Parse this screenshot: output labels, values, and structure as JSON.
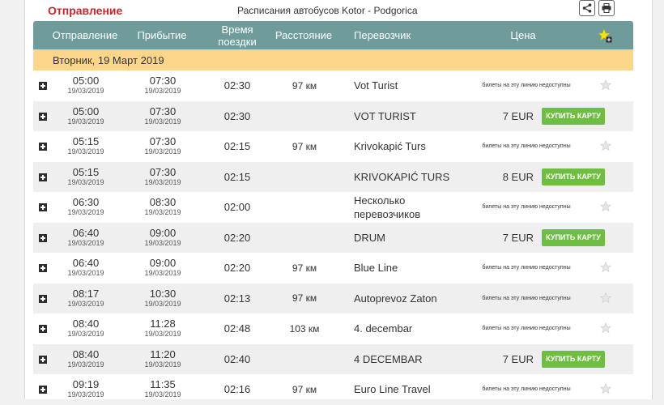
{
  "header": {
    "departure_label": "Отправление",
    "title": "Расписания автобусов Kotor - Podgorica"
  },
  "columns": {
    "departure": "Отправление",
    "arrival": "Прибытие",
    "duration": "Время поездки",
    "distance": "Расстояние",
    "carrier": "Перевозчик",
    "price": "Цена"
  },
  "date_header": "Вторник, 19 Март 2019",
  "buy_label": "КУПИТЬ КАРТУ",
  "rows": [
    {
      "dep_time": "05:00",
      "dep_date": "19/03/2019",
      "arr_time": "07:30",
      "arr_date": "19/03/2019",
      "duration": "02:30",
      "distance": "97 км",
      "carrier": "Vot Turist",
      "price": "",
      "note": "билеты на эту линию недоступны"
    },
    {
      "dep_time": "05:00",
      "dep_date": "19/03/2019",
      "arr_time": "07:30",
      "arr_date": "19/03/2019",
      "duration": "02:30",
      "distance": "",
      "carrier": "VOT TURIST",
      "price": "7 EUR",
      "note": ""
    },
    {
      "dep_time": "05:15",
      "dep_date": "19/03/2019",
      "arr_time": "07:30",
      "arr_date": "19/03/2019",
      "duration": "02:15",
      "distance": "97 км",
      "carrier": "Krivokapić Turs",
      "price": "",
      "note": "билеты на эту линию недоступны"
    },
    {
      "dep_time": "05:15",
      "dep_date": "19/03/2019",
      "arr_time": "07:30",
      "arr_date": "19/03/2019",
      "duration": "02:15",
      "distance": "",
      "carrier": "KRIVOKAPIĆ TURS",
      "price": "8 EUR",
      "note": ""
    },
    {
      "dep_time": "06:30",
      "dep_date": "19/03/2019",
      "arr_time": "08:30",
      "arr_date": "19/03/2019",
      "duration": "02:00",
      "distance": "",
      "carrier": "Несколько перевозчиков",
      "price": "",
      "note": "билеты на эту линию недоступны"
    },
    {
      "dep_time": "06:40",
      "dep_date": "19/03/2019",
      "arr_time": "09:00",
      "arr_date": "19/03/2019",
      "duration": "02:20",
      "distance": "",
      "carrier": "DRUM",
      "price": "7 EUR",
      "note": ""
    },
    {
      "dep_time": "06:40",
      "dep_date": "19/03/2019",
      "arr_time": "09:00",
      "arr_date": "19/03/2019",
      "duration": "02:20",
      "distance": "97 км",
      "carrier": "Blue Line",
      "price": "",
      "note": "билеты на эту линию недоступны"
    },
    {
      "dep_time": "08:17",
      "dep_date": "19/03/2019",
      "arr_time": "10:30",
      "arr_date": "19/03/2019",
      "duration": "02:13",
      "distance": "97 км",
      "carrier": "Autoprevoz Zaton",
      "price": "",
      "note": "билеты на эту линию недоступны"
    },
    {
      "dep_time": "08:40",
      "dep_date": "19/03/2019",
      "arr_time": "11:28",
      "arr_date": "19/03/2019",
      "duration": "02:48",
      "distance": "103 км",
      "carrier": "4. decembar",
      "price": "",
      "note": "билеты на эту линию недоступны"
    },
    {
      "dep_time": "08:40",
      "dep_date": "19/03/2019",
      "arr_time": "11:20",
      "arr_date": "19/03/2019",
      "duration": "02:40",
      "distance": "",
      "carrier": "4 DECEMBAR",
      "price": "7 EUR",
      "note": ""
    },
    {
      "dep_time": "09:19",
      "dep_date": "19/03/2019",
      "arr_time": "11:35",
      "arr_date": "19/03/2019",
      "duration": "02:16",
      "distance": "97 км",
      "carrier": "Euro Line Travel",
      "price": "",
      "note": "билеты на эту линию недоступны"
    }
  ],
  "colors": {
    "header_bg": "#6f9c9b",
    "date_bg": "#fdd68b",
    "accent_red": "#c0282e",
    "buy_green": "#6fbd44"
  },
  "icons": {
    "share": "share-icon",
    "print": "print-icon",
    "favorites": "star-add-icon",
    "expand": "plus-icon",
    "row_favorite": "star-icon"
  }
}
